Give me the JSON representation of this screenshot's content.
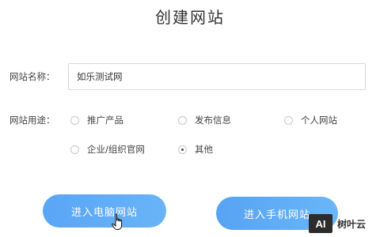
{
  "page": {
    "title": "创建网站"
  },
  "form": {
    "site_name": {
      "label": "网站名称：",
      "value": "如乐测试网"
    },
    "site_purpose": {
      "label": "网站用途：",
      "options": [
        {
          "label": "推广产品",
          "selected": false
        },
        {
          "label": "发布信息",
          "selected": false
        },
        {
          "label": "个人网站",
          "selected": false
        },
        {
          "label": "企业/组织官网",
          "selected": false
        },
        {
          "label": "其他",
          "selected": true
        }
      ]
    }
  },
  "buttons": {
    "enter_pc": "进入电脑网站",
    "enter_mobile": "进入手机网站"
  },
  "watermark": {
    "logo": "AI",
    "text": "树叶云"
  },
  "colors": {
    "button_blue": "#5aa6f5",
    "radio_border": "#c8c8c8"
  },
  "icons": {
    "cursor": "hand-pointer-icon"
  }
}
